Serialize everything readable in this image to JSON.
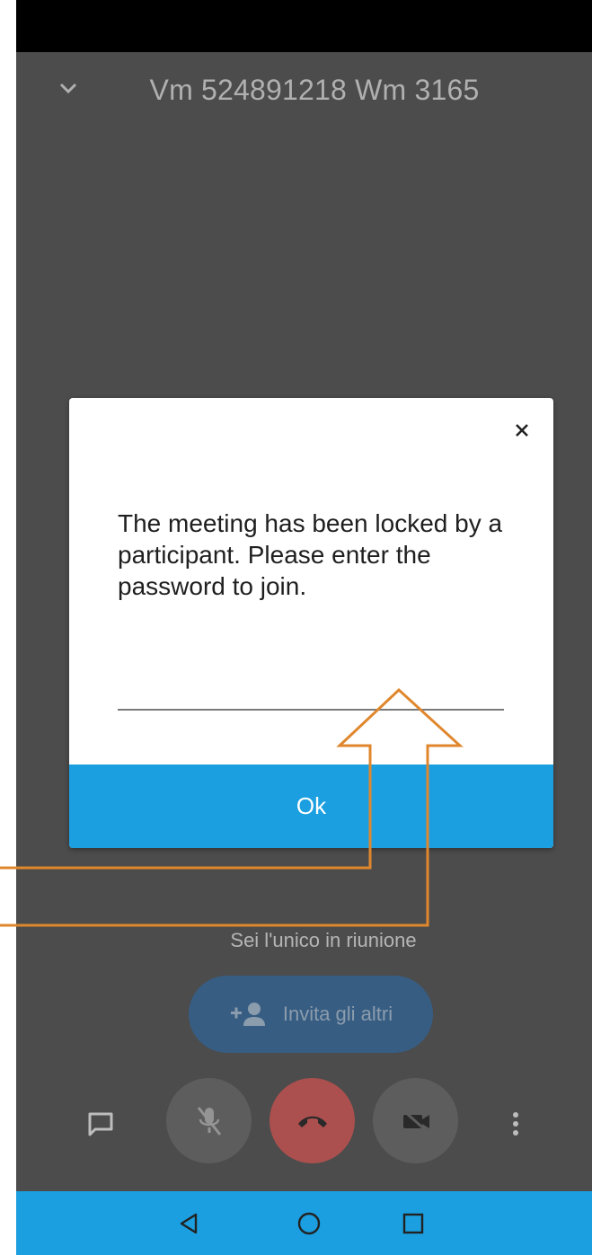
{
  "meeting": {
    "title": "Vm 524891218 Wm 3165"
  },
  "dialog": {
    "message": "The meeting has been locked by a participant. Please enter the password to join.",
    "password_value": "",
    "ok_label": "Ok"
  },
  "participants": {
    "status_text": "Sei l'unico in riunione",
    "invite_label": "Invita gli altri"
  },
  "icons": {
    "collapse": "chevron-down-icon",
    "close": "close-icon",
    "invite": "add-person-icon",
    "chat": "chat-icon",
    "mic": "mic-off-icon",
    "hangup": "hang-up-icon",
    "video": "video-off-icon",
    "more": "more-vertical-icon",
    "back": "back-icon",
    "home": "home-icon",
    "recent": "recent-apps-icon"
  },
  "colors": {
    "background": "#575757",
    "accent": "#1b9fe0",
    "hangup": "#c35c59",
    "invite": "#3f6a96",
    "annotation": "#e0872d"
  }
}
